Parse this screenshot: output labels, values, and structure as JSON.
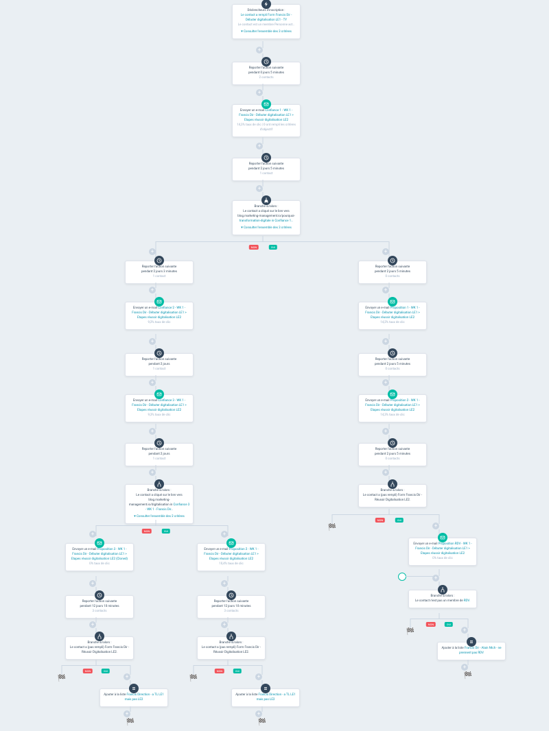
{
  "trigger": {
    "title": "Déclencheurs d'inscription :",
    "cond": "Le contact a rempli Form Francis Dir - Débuter digitalisation LE1 - TY",
    "note": "Le contact est un membre Personne act…",
    "view": "Consulter l'ensemble des 3 critères"
  },
  "delay1": {
    "line1": "Reporter l'action suivante",
    "line2": "pendant 0 jours 5 minutes",
    "meta": "2 contacts"
  },
  "email1": {
    "pre": "Envoyer un e-mail ",
    "name": "Confiance 1 - WK 1 - Francis Dir - Débuter digitalisation LE1 > Etapes réussir digitalisation LE2",
    "meta": "14,3% taux de clic | 0 ont rempli les critères d'objectif"
  },
  "delay2": {
    "line1": "Reporter l'action suivante",
    "line2": "pendant 2 jours 5 minutes",
    "meta": "1 contact"
  },
  "branch1": {
    "title": "Branche si/alors :",
    "cond": "Le contact a cliqué sur le lien vers blog.marketing-management.io/pourquoi-",
    "ref": "transformation-digitale in Confiance 1…",
    "view": "Consulter l'ensemble des 3 critères"
  },
  "left": {
    "delayA": {
      "line1": "Reporter l'action suivante",
      "line2": "pendant 2 jours 3 minutes",
      "meta": "1 contact"
    },
    "emailA": {
      "pre": "Envoyer un e-mail ",
      "name": "Confiance 2 - WK 1 - Francis Dir - Débuter digitalisation LE1 > Etapes réussir digitalisation LE2",
      "meta": "9,2% taux de clic"
    },
    "delayB": {
      "line1": "Reporter l'action suivante",
      "line2": "pendant 2 jours",
      "meta": "1 contact"
    },
    "emailB": {
      "pre": "Envoyer un e-mail ",
      "name": "Confiance 3 - WK 1 - Francis Dir - Débuter digitalisation LE1 > Etapes réussir digitalisation LE2",
      "meta": "9,3% taux de clic"
    },
    "delayC": {
      "line1": "Reporter l'action suivante",
      "line2": "pendant 2 jours",
      "meta": "1 contact"
    },
    "branch2": {
      "title": "Branche si/alors :",
      "cond": "Le contact a cliqué sur le lien vers blog.marketing-management.io/digitalisation in ",
      "ref": "Confiance 3 - WK 1 - Francis Dir…",
      "view": "Consulter l'ensemble des 2 critères"
    },
    "no": {
      "emailP3": {
        "pre": "Envoyer un e-mail ",
        "name": "Proposition 3 - WK 1 - Francis Dir - Débuter digitalisation LE1 > Etapes réussir digitalisation LE2 (Cloned)",
        "meta": "0% taux de clic"
      },
      "delayD": {
        "line1": "Reporter l'action suivante",
        "line2": "pendant 12 jours 10 minutes",
        "meta": "3 contacts"
      },
      "branch4": {
        "title": "Branche si/alors :",
        "cond": "Le contact a (pas rempli) Form Francis Dir - Réussir Digitalisation LE2."
      },
      "listYes": {
        "pre": "Ajouter à la liste ",
        "name": "Francis Direction - a TL LE1 mais pas LE2"
      }
    },
    "yes": {
      "emailP2": {
        "pre": "Envoyer un e-mail ",
        "name": "Proposition 2 - WK 1 - Francis Dir - Débuter digitalisation LE1 > Etapes réussir digitalisation LE2",
        "meta": "10,4% taux de clic"
      },
      "delayE": {
        "line1": "Reporter l'action suivante",
        "line2": "pendant 12 jours 10 minutes",
        "meta": "3 contacts"
      },
      "branch5": {
        "title": "Branche si/alors :",
        "cond": "Le contact a (pas rempli) Form Francis Dir - Réussir Digitalisation LE2."
      },
      "listYes": {
        "pre": "Ajouter à la liste ",
        "name": "Francis Direction - a TL LE1 mais pas LE2"
      }
    }
  },
  "right": {
    "delayA": {
      "line1": "Reporter l'action suivante",
      "line2": "pendant 2 jours 5 minutes",
      "meta": "0 contacts"
    },
    "emailA": {
      "pre": "Envoyer un e-mail ",
      "name": "Proposition 1 - WK 1 - Francis Dir - Débuter digitalisation LE1 > Etapes réussir digitalisation LE2",
      "meta": "14,2% taux de clic"
    },
    "delayB": {
      "line1": "Reporter l'action suivante",
      "line2": "pendant 2 jours 5 minutes",
      "meta": "0 contacts"
    },
    "emailB": {
      "pre": "Envoyer un e-mail ",
      "name": "Proposition 2 - WK 1 - Francis Dir - Débuter digitalisation LE1 > Etapes réussir digitalisation LE2",
      "meta": "14,3% taux de clic"
    },
    "delayC": {
      "line1": "Reporter l'action suivante",
      "line2": "pendant 2 jours 5 minutes",
      "meta": "0 contacts"
    },
    "branch3": {
      "title": "Branche si/alors :",
      "cond": "Le contact a (pas rempli) Form Francis Dir - Réussir Digitalisation LE2."
    },
    "yes": {
      "emailRDV": {
        "pre": "Envoyer un e-mail ",
        "name": "Proposition RDV - WK 1 - Francis Dir - Débuter digitalisation LE1 > Etapes réussir digitalisation LE2",
        "meta": "0% taux de clic"
      },
      "branchRDV": {
        "title": "Branche si/alors :",
        "cond": "Le contact n'est pas un membre de ",
        "ref": "RDV."
      },
      "listYes": {
        "pre": "Ajouter à la liste ",
        "name": "Francis Dir - Alain Ntch - ne prennent pas RDV"
      }
    }
  },
  "labels": {
    "no": "NON",
    "yes": "OUI"
  }
}
